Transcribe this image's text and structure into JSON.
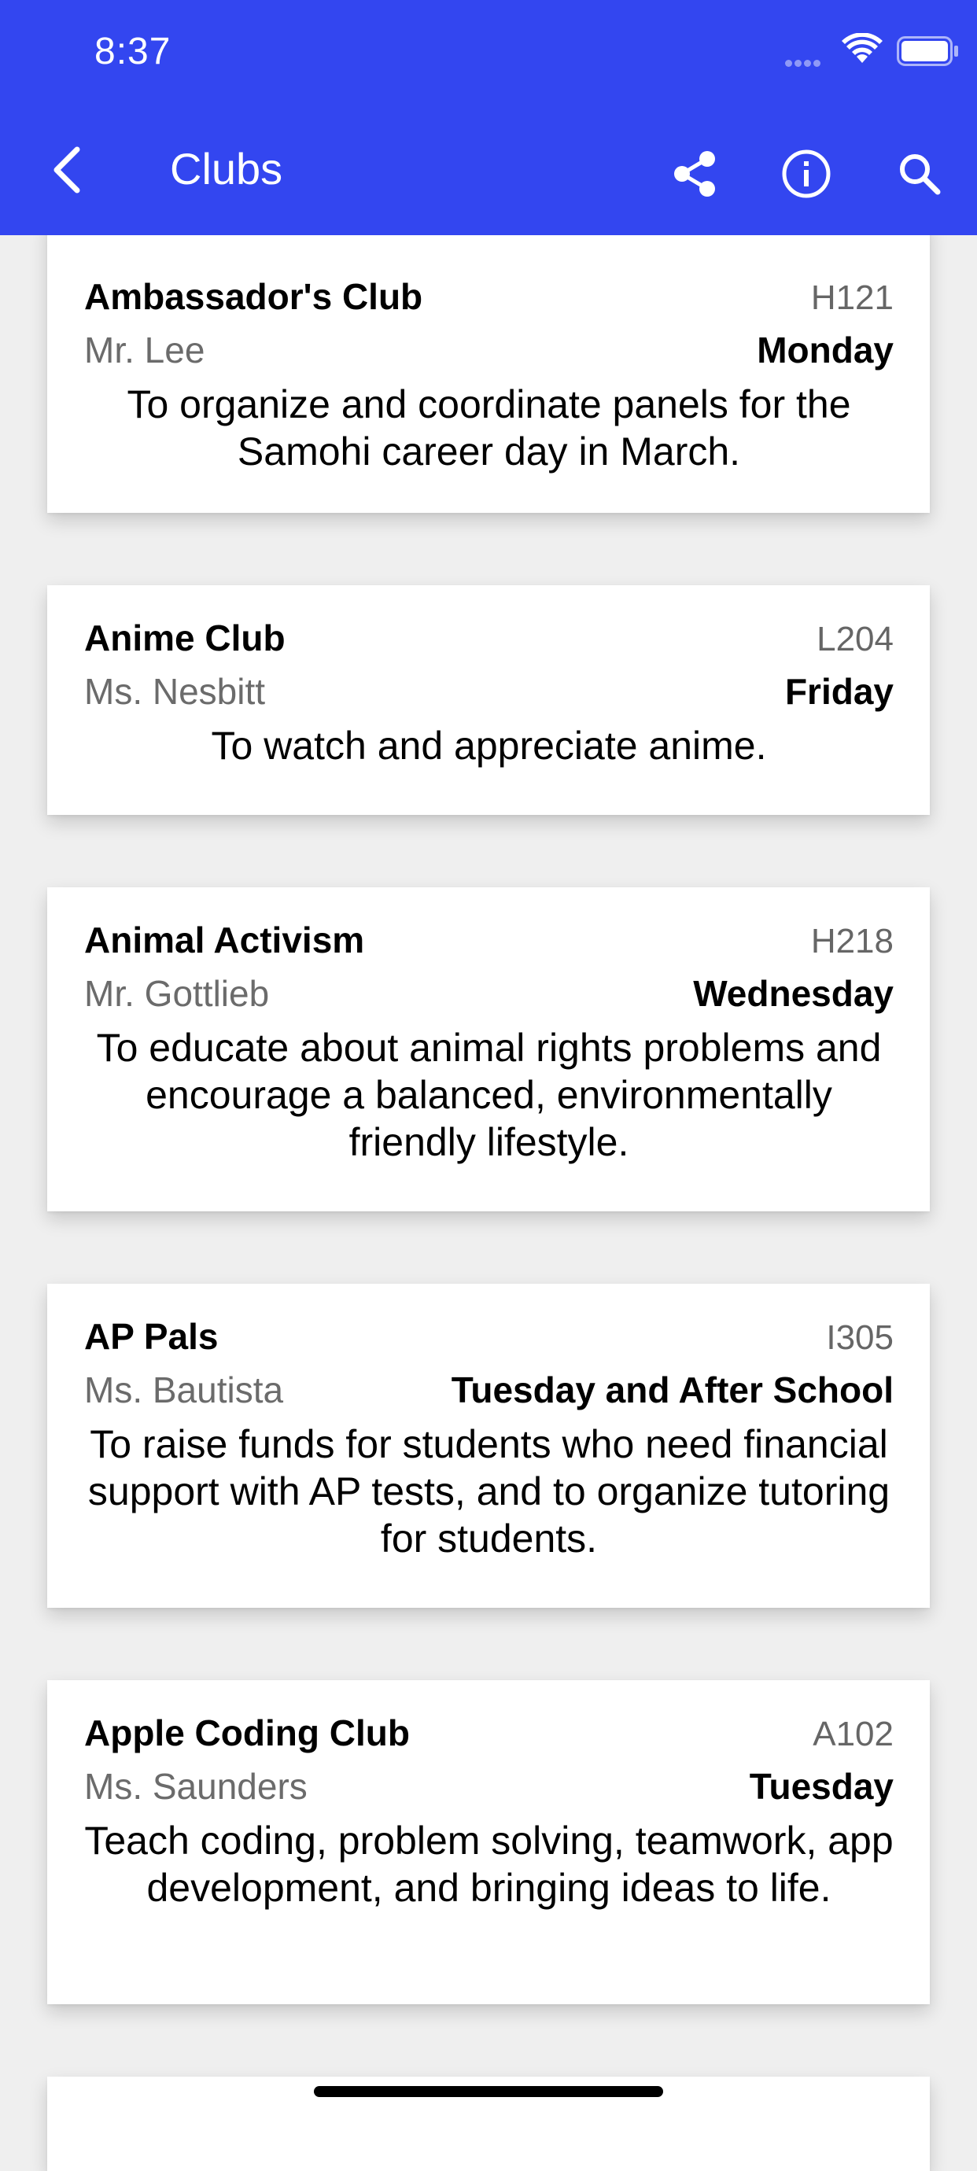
{
  "status_bar": {
    "time": "8:37"
  },
  "header": {
    "title": "Clubs",
    "background_color": "#3346f0",
    "icons": [
      "chevron-left-icon",
      "share-icon",
      "info-icon",
      "search-icon"
    ]
  },
  "clubs": [
    {
      "name": "Ambassador's Club",
      "room": "H121",
      "advisor": "Mr. Lee",
      "day": "Monday",
      "description": "To organize and coordinate panels for the Samohi career day in March."
    },
    {
      "name": "Anime Club",
      "room": "L204",
      "advisor": "Ms. Nesbitt",
      "day": "Friday",
      "description": "To watch and appreciate anime."
    },
    {
      "name": "Animal Activism",
      "room": "H218",
      "advisor": "Mr. Gottlieb",
      "day": "Wednesday",
      "description": "To educate about animal rights problems and encourage a balanced, environmentally friendly lifestyle."
    },
    {
      "name": "AP Pals",
      "room": "I305",
      "advisor": "Ms. Bautista",
      "day": "Tuesday and After School",
      "description": "To raise funds for students who need financial support with AP tests, and to organize tutoring for students."
    },
    {
      "name": "Apple Coding Club",
      "room": "A102",
      "advisor": "Ms. Saunders",
      "day": "Tuesday",
      "description": "Teach coding, problem solving, teamwork, app development, and bringing ideas to life."
    }
  ]
}
